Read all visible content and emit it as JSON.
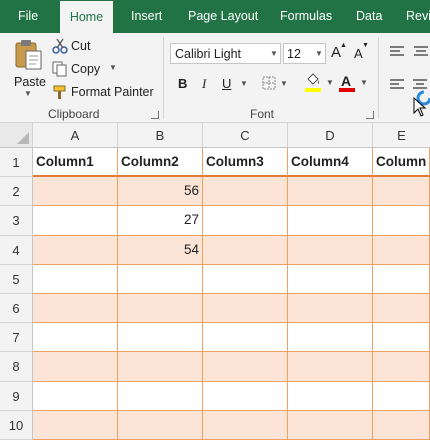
{
  "tabs": [
    {
      "label": "File",
      "active": false
    },
    {
      "label": "Home",
      "active": true
    },
    {
      "label": "Insert",
      "active": false
    },
    {
      "label": "Page Layout",
      "active": false
    },
    {
      "label": "Formulas",
      "active": false
    },
    {
      "label": "Data",
      "active": false
    },
    {
      "label": "Revi",
      "active": false
    }
  ],
  "clipboard": {
    "paste_label": "Paste",
    "cut_label": "Cut",
    "copy_label": "Copy",
    "format_painter_label": "Format Painter",
    "group_label": "Clipboard"
  },
  "font": {
    "font_name": "Calibri Light",
    "font_size": "12",
    "bold": "B",
    "italic": "I",
    "underline": "U",
    "grow_label": "A",
    "shrink_label": "A",
    "font_color_label": "A",
    "group_label": "Font",
    "highlight_color": "#ffff00",
    "font_color": "#e00000"
  },
  "columns": [
    "A",
    "B",
    "C",
    "D",
    "E"
  ],
  "rows": [
    "1",
    "2",
    "3",
    "4",
    "5",
    "6",
    "7",
    "8",
    "9",
    "10"
  ],
  "table": {
    "headers": [
      "Column1",
      "Column2",
      "Column3",
      "Column4",
      "Column"
    ],
    "rows": [
      [
        "",
        "56",
        "",
        "",
        ""
      ],
      [
        "",
        "27",
        "",
        "",
        ""
      ],
      [
        "",
        "54",
        "",
        "",
        ""
      ],
      [
        "",
        "",
        "",
        "",
        ""
      ],
      [
        "",
        "",
        "",
        "",
        ""
      ],
      [
        "",
        "",
        "",
        "",
        ""
      ],
      [
        "",
        "",
        "",
        "",
        ""
      ],
      [
        "",
        "",
        "",
        "",
        ""
      ],
      [
        "",
        "",
        "",
        "",
        ""
      ]
    ],
    "band_color": "#fce4d6",
    "border_color": "#f0a060"
  },
  "theme": {
    "accent": "#217346"
  }
}
